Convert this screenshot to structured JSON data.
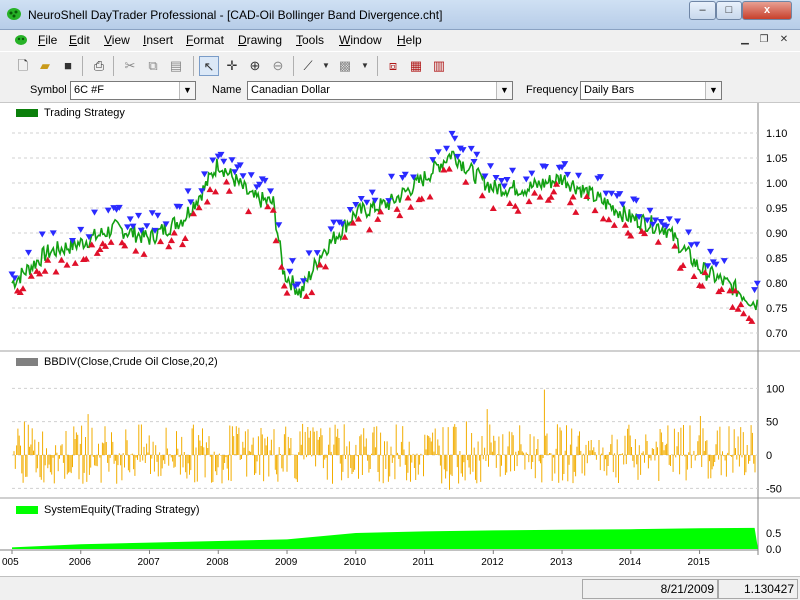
{
  "window": {
    "title": "NeuroShell DayTrader Professional - [CAD-Oil Bollinger Band Divergence.cht]",
    "minimize_label": "–",
    "maximize_label": "□",
    "close_label": "x"
  },
  "menu": {
    "items": [
      {
        "label": "File",
        "key": "F",
        "rest": "ile"
      },
      {
        "label": "Edit",
        "key": "E",
        "rest": "dit"
      },
      {
        "label": "View",
        "key": "V",
        "rest": "iew"
      },
      {
        "label": "Insert",
        "key": "I",
        "rest": "nsert"
      },
      {
        "label": "Format",
        "key": "F",
        "rest": "ormat"
      },
      {
        "label": "Drawing",
        "key": "D",
        "rest": "rawing"
      },
      {
        "label": "Tools",
        "key": "T",
        "rest": "ools"
      },
      {
        "label": "Window",
        "key": "W",
        "rest": "indow"
      },
      {
        "label": "Help",
        "key": "H",
        "rest": "elp"
      }
    ]
  },
  "toolbar": {
    "icons": [
      "new-file-icon",
      "open-folder-icon",
      "save-icon",
      "print-icon",
      "cut-icon",
      "copy-icon",
      "paste-icon",
      "pointer-icon",
      "crosshair-icon",
      "zoom-in-icon",
      "zoom-out-icon",
      "draw-line-icon",
      "dropdown-icon",
      "pattern-icon",
      "dropdown-icon",
      "chart-properties-icon",
      "chart-page-icon",
      "indicator-wizard-icon"
    ]
  },
  "symbol_bar": {
    "symbol_label": "Symbol",
    "symbol_value": "6C #F",
    "name_label": "Name",
    "name_value": "Canadian Dollar",
    "frequency_label": "Frequency",
    "frequency_value": "Daily Bars"
  },
  "panes": {
    "price": {
      "title": "Trading Strategy",
      "swatch": "#0b7f0b"
    },
    "indicator": {
      "title": "BBDIV(Close,Crude Oil Close,20,2)",
      "swatch": "#808080"
    },
    "equity": {
      "title": "SystemEquity(Trading Strategy)",
      "swatch": "#00ff00"
    }
  },
  "colors": {
    "price_line": "#12a012",
    "buy_marker": "#e0102a",
    "sell_marker": "#2a2aff",
    "indicator_bars": "#f2ad00",
    "equity_fill": "#00ff00",
    "grid": "#d0d0d0"
  },
  "chart_data": [
    {
      "type": "line",
      "title": "Trading Strategy",
      "x": [
        "2005",
        "2005.5",
        "2006",
        "2006.5",
        "2007",
        "2007.5",
        "2007.8",
        "2008",
        "2008.5",
        "2008.8",
        "2008.95",
        "2009.2",
        "2009.5",
        "2010",
        "2010.5",
        "2011",
        "2011.4",
        "2011.7",
        "2012",
        "2012.5",
        "2013",
        "2013.5",
        "2014",
        "2014.5",
        "2015",
        "2015.5",
        "2015.8"
      ],
      "series": [
        {
          "values": [
            0.8,
            0.86,
            0.88,
            0.91,
            0.89,
            0.93,
            0.99,
            1.04,
            0.97,
            0.96,
            0.82,
            0.78,
            0.86,
            0.94,
            0.96,
            1.01,
            1.06,
            1.02,
            0.99,
            0.99,
            1.01,
            0.97,
            0.93,
            0.91,
            0.83,
            0.79,
            0.76
          ]
        }
      ],
      "yticks": [
        "1.10",
        "1.05",
        "1.00",
        "0.95",
        "0.90",
        "0.85",
        "0.80",
        "0.75",
        "0.70"
      ],
      "ylim": [
        0.68,
        1.12
      ],
      "grid": true
    },
    {
      "type": "bar",
      "title": "BBDIV(Close,Crude Oil Close,20,2)",
      "yticks": [
        "100",
        "50",
        "0",
        "-50"
      ],
      "ylim": [
        -60,
        120
      ],
      "grid": true
    },
    {
      "type": "area",
      "title": "SystemEquity(Trading Strategy)",
      "x": [
        "2005",
        "2006",
        "2007",
        "2008",
        "2009",
        "2010",
        "2011",
        "2012",
        "2013",
        "2014",
        "2015",
        "2015.8"
      ],
      "values": [
        0.05,
        0.15,
        0.2,
        0.25,
        0.3,
        0.5,
        0.55,
        0.58,
        0.6,
        0.62,
        0.65,
        0.66
      ],
      "yticks": [
        "0.5",
        "0.0"
      ],
      "ylim": [
        0,
        1
      ],
      "xticks": [
        "005",
        "2006",
        "2007",
        "2008",
        "2009",
        "2010",
        "2011",
        "2012",
        "2013",
        "2014",
        "2015"
      ]
    }
  ],
  "status": {
    "date": "8/21/2009",
    "value": "1.130427"
  }
}
